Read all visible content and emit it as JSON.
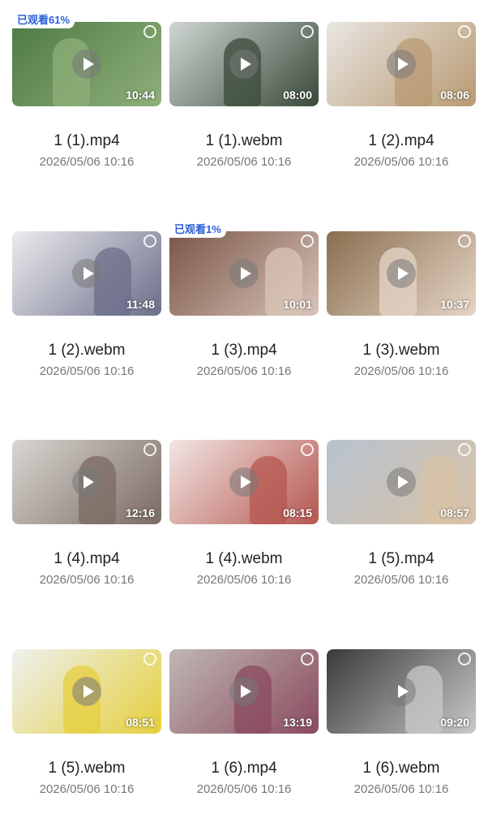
{
  "videos": [
    {
      "name": "1 (1).mp4",
      "date": "2026/05/06 10:16",
      "duration": "10:44",
      "badge": "已观看61%",
      "bg": "#4f7a45",
      "accent": "#8fb07a"
    },
    {
      "name": "1 (1).webm",
      "date": "2026/05/06 10:16",
      "duration": "08:00",
      "badge": "",
      "bg": "#cfd6d2",
      "accent": "#3a4a3a"
    },
    {
      "name": "1 (2).mp4",
      "date": "2026/05/06 10:16",
      "duration": "08:06",
      "badge": "",
      "bg": "#e9e6e2",
      "accent": "#b89a72"
    },
    {
      "name": "1 (2).webm",
      "date": "2026/05/06 10:16",
      "duration": "11:48",
      "badge": "",
      "bg": "#ececee",
      "accent": "#6b6e8a"
    },
    {
      "name": "1 (3).mp4",
      "date": "2026/05/06 10:16",
      "duration": "10:01",
      "badge": "已观看1%",
      "bg": "#7a5648",
      "accent": "#d9c4b8"
    },
    {
      "name": "1 (3).webm",
      "date": "2026/05/06 10:16",
      "duration": "10:37",
      "badge": "",
      "bg": "#8a6e4f",
      "accent": "#e6d6c7"
    },
    {
      "name": "1 (4).mp4",
      "date": "2026/05/06 10:16",
      "duration": "12:16",
      "badge": "",
      "bg": "#d9d6d2",
      "accent": "#7a6a62"
    },
    {
      "name": "1 (4).webm",
      "date": "2026/05/06 10:16",
      "duration": "08:15",
      "badge": "",
      "bg": "#f2e6e4",
      "accent": "#b5564f"
    },
    {
      "name": "1 (5).mp4",
      "date": "2026/05/06 10:16",
      "duration": "08:57",
      "badge": "",
      "bg": "#b7c3cf",
      "accent": "#d8c1a6"
    },
    {
      "name": "1 (5).webm",
      "date": "2026/05/06 10:16",
      "duration": "08:51",
      "badge": "",
      "bg": "#eef1f0",
      "accent": "#e5cf3c"
    },
    {
      "name": "1 (6).mp4",
      "date": "2026/05/06 10:16",
      "duration": "13:19",
      "badge": "",
      "bg": "#bfb8b4",
      "accent": "#8a4a5e"
    },
    {
      "name": "1 (6).webm",
      "date": "2026/05/06 10:16",
      "duration": "09:20",
      "badge": "",
      "bg": "#3a3a3a",
      "accent": "#c9c9c9"
    }
  ]
}
